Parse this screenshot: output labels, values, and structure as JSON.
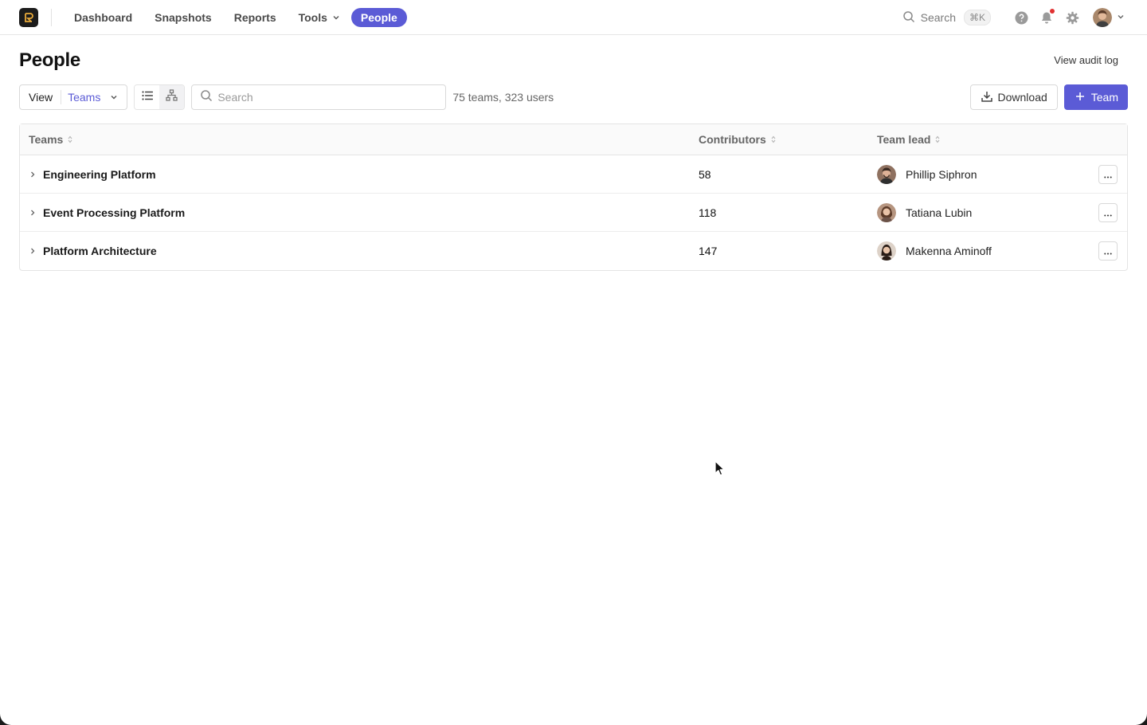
{
  "nav": {
    "items": [
      {
        "label": "Dashboard"
      },
      {
        "label": "Snapshots"
      },
      {
        "label": "Reports"
      },
      {
        "label": "Tools"
      },
      {
        "label": "People"
      }
    ],
    "search_label": "Search",
    "search_shortcut": "⌘K"
  },
  "page": {
    "title": "People",
    "audit_link": "View audit log"
  },
  "toolbar": {
    "view_label": "View",
    "view_value": "Teams",
    "search_placeholder": "Search",
    "count_text": "75 teams, 323 users",
    "download_label": "Download",
    "add_team_label": "Team"
  },
  "table": {
    "headers": {
      "team": "Teams",
      "contributors": "Contributors",
      "lead": "Team lead"
    },
    "rows": [
      {
        "team": "Engineering Platform",
        "contributors": "58",
        "lead": "Phillip Siphron"
      },
      {
        "team": "Event Processing Platform",
        "contributors": "118",
        "lead": "Tatiana Lubin"
      },
      {
        "team": "Platform Architecture",
        "contributors": "147",
        "lead": "Makenna Aminoff"
      }
    ]
  },
  "colors": {
    "accent": "#5b5bd6",
    "notification": "#e03131"
  },
  "icons": [
    "logo-icon",
    "chevron-down-icon",
    "search-icon",
    "help-icon",
    "bell-icon",
    "gear-icon",
    "list-view-icon",
    "org-chart-icon",
    "download-icon",
    "plus-icon",
    "sort-icon",
    "chevron-right-icon",
    "more-icon"
  ]
}
